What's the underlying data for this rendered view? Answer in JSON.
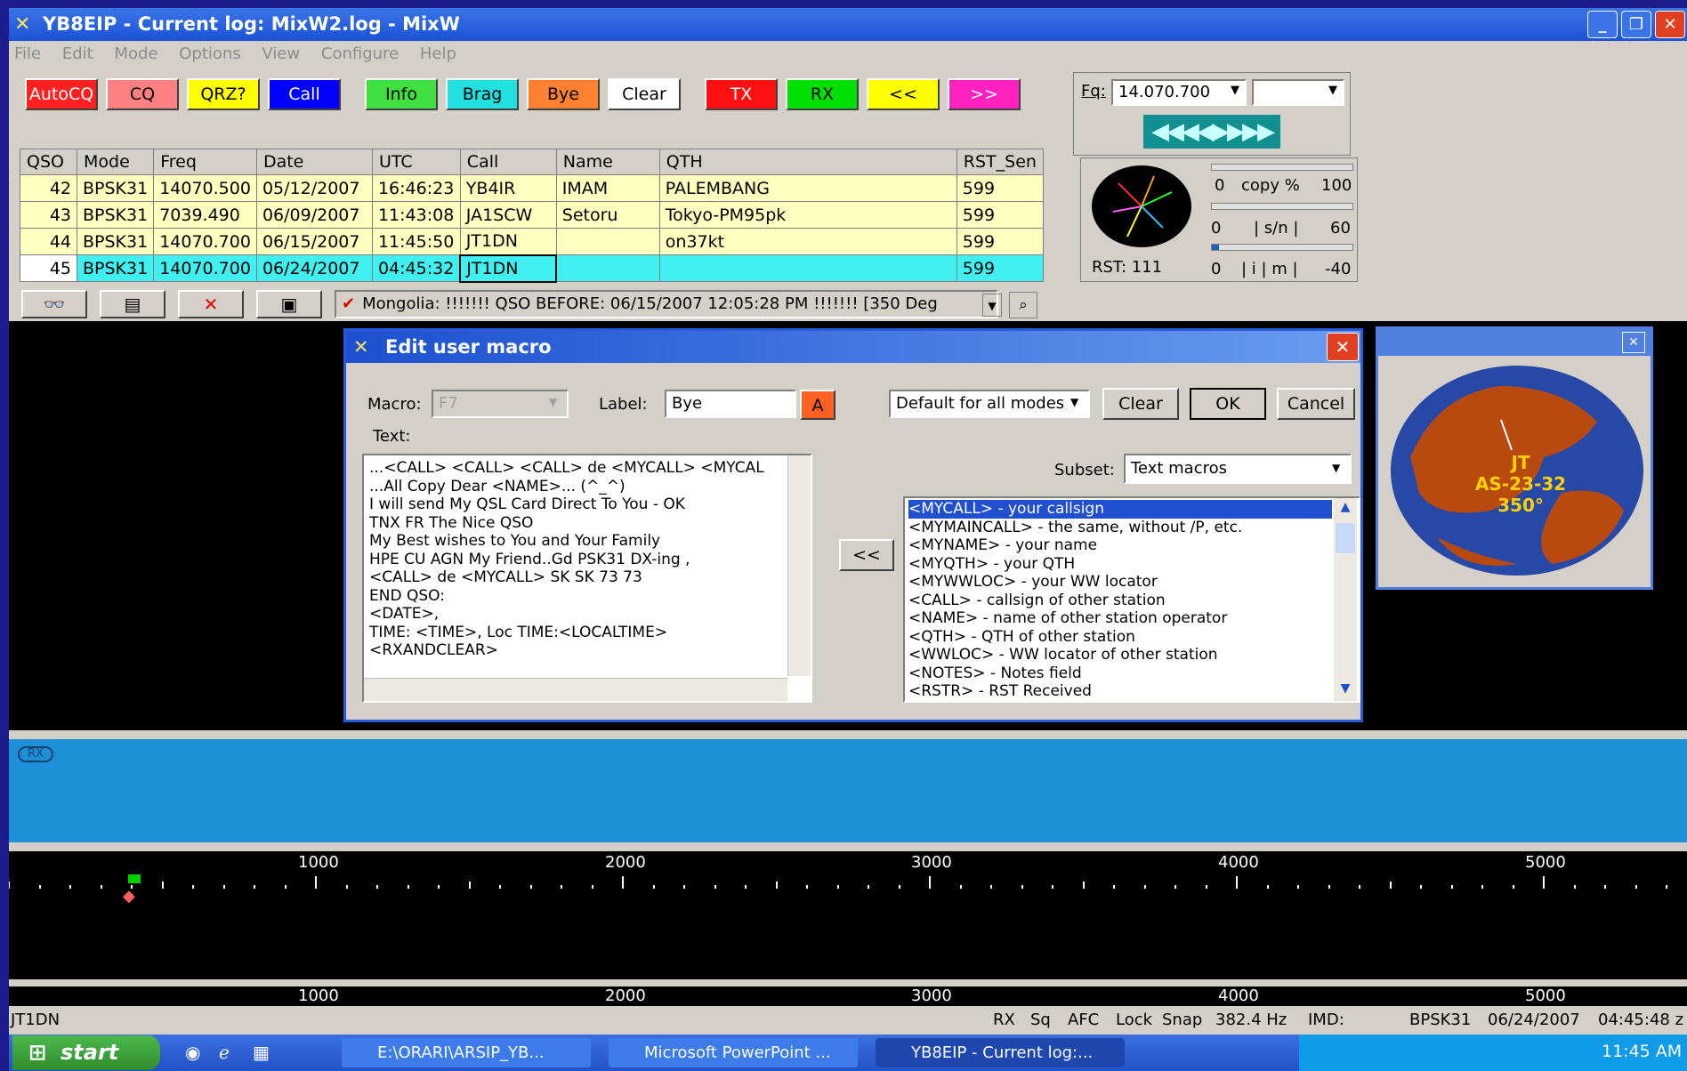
{
  "window": {
    "title": "YB8EIP - Current log: MixW2.log - MixW"
  },
  "menu": [
    "File",
    "Edit",
    "Mode",
    "Options",
    "View",
    "Configure",
    "Help"
  ],
  "macro_buttons": [
    {
      "label": "AutoCQ",
      "bg": "#ff2020",
      "fg": "#ffffff"
    },
    {
      "label": "CQ",
      "bg": "#ff8080",
      "fg": "#000000"
    },
    {
      "label": "QRZ?",
      "bg": "#ffff00",
      "fg": "#000000"
    },
    {
      "label": "Call",
      "bg": "#0000ff",
      "fg": "#ffffff"
    },
    {
      "label": "Info",
      "bg": "#40e040",
      "fg": "#000000"
    },
    {
      "label": "Brag",
      "bg": "#20e0e0",
      "fg": "#000000"
    },
    {
      "label": "Bye",
      "bg": "#ff8030",
      "fg": "#000000"
    },
    {
      "label": "Clear",
      "bg": "#ffffff",
      "fg": "#000000"
    },
    {
      "label": "TX",
      "bg": "#ff1010",
      "fg": "#ffffff"
    },
    {
      "label": "RX",
      "bg": "#00e000",
      "fg": "#000000"
    },
    {
      "label": "<<",
      "bg": "#ffff00",
      "fg": "#000000"
    },
    {
      "label": ">>",
      "bg": "#ff20c0",
      "fg": "#ffffff"
    }
  ],
  "freq_panel": {
    "label": "Fq:",
    "value": "14.070.700"
  },
  "tuning_panel": {
    "copy": {
      "min": "0",
      "label": "copy %",
      "max": "100"
    },
    "sn": {
      "min": "0",
      "label": "| s/n |",
      "max": "60"
    },
    "imd": {
      "min": "0",
      "label": "| i | m |",
      "max": "-40"
    },
    "rst": "RST: 111"
  },
  "log": {
    "columns": [
      "QSO",
      "Mode",
      "Freq",
      "Date",
      "UTC",
      "Call",
      "Name",
      "QTH",
      "RST_Sen"
    ],
    "rows": [
      [
        "42",
        "BPSK31",
        "14070.500",
        "05/12/2007",
        "16:46:23",
        "YB4IR",
        "IMAM",
        "PALEMBANG",
        "599"
      ],
      [
        "43",
        "BPSK31",
        "7039.490",
        "06/09/2007",
        "11:43:08",
        "JA1SCW",
        "Setoru",
        "Tokyo-PM95pk",
        "599"
      ],
      [
        "44",
        "BPSK31",
        "14070.700",
        "06/15/2007",
        "11:45:50",
        "JT1DN",
        "",
        "on37kt",
        "599"
      ],
      [
        "45",
        "BPSK31",
        "14070.700",
        "06/24/2007",
        "04:45:32",
        "JT1DN",
        "",
        "",
        "599"
      ]
    ]
  },
  "info_line": "Mongolia:  !!!!!!! QSO BEFORE: 06/15/2007 12:05:28 PM !!!!!!! [350 Deg",
  "dialog": {
    "title": "Edit user macro",
    "macro_label": "Macro:",
    "macro_value": "F7",
    "label_label": "Label:",
    "label_value": "Bye",
    "color_btn": "A",
    "mode_select": "Default for all modes",
    "clear": "Clear",
    "ok": "OK",
    "cancel": "Cancel",
    "text_label": "Text:",
    "text_lines": [
      "...<CALL>  <CALL> <CALL> de  <MYCALL>   <MYCAL",
      "...All Copy Dear  <NAME>... (^_^)",
      "I will send My QSL Card Direct To You - OK",
      "TNX FR The Nice QSO",
      "My Best wishes to You and Your Family",
      "HPE CU AGN My Friend..Gd PSK31 DX-ing ,",
      "<CALL> de <MYCALL> SK SK 73 73",
      "END QSO:",
      "<DATE>,",
      "TIME: <TIME>,  Loc TIME:<LOCALTIME>",
      "<RXANDCLEAR>"
    ],
    "insert_btn": "<<",
    "subset_label": "Subset:",
    "subset_value": "Text macros",
    "macros": [
      "<MYCALL> - your callsign",
      "<MYMAINCALL> - the same, without /P, etc.",
      "<MYNAME> - your name",
      "<MYQTH> - your QTH",
      "<MYWWLOC> - your WW locator",
      "<CALL> - callsign of other station",
      "<NAME> - name of other station operator",
      "<QTH> - QTH of other station",
      "<WWLOC> - WW locator of other station",
      "<NOTES> - Notes field",
      "<RSTR> - RST Received"
    ]
  },
  "globe": {
    "prefix": "JT",
    "zone": "AS-23-32",
    "bearing": "350°"
  },
  "rx_badge": "RX",
  "scale_labels": [
    "1000",
    "2000",
    "3000",
    "4000",
    "5000"
  ],
  "status": {
    "call": "JT1DN",
    "items": [
      "RX",
      "Sq",
      "AFC",
      "Lock",
      "Snap",
      "382.4 Hz",
      "IMD:",
      "",
      "BPSK31",
      "06/24/2007",
      "04:45:48 z"
    ]
  },
  "taskbar": {
    "start": "start",
    "tasks": [
      "E:\\ORARI\\ARSIP_YB...",
      "Microsoft PowerPoint ...",
      "YB8EIP - Current log:..."
    ],
    "time": "11:45 AM"
  }
}
